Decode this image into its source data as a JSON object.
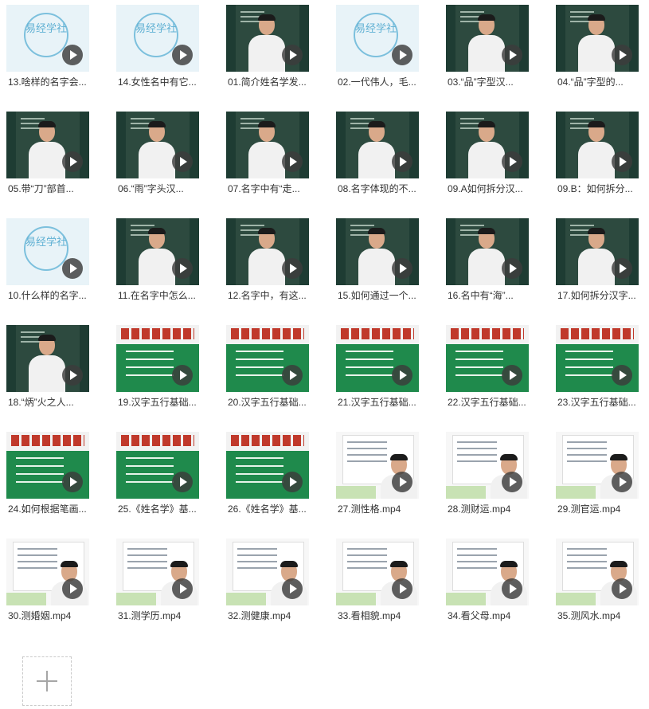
{
  "files": [
    {
      "label": "13.啥样的名字会...",
      "thumb": "logo"
    },
    {
      "label": "14.女性名中有它...",
      "thumb": "logo"
    },
    {
      "label": "01.简介姓名学发...",
      "thumb": "board"
    },
    {
      "label": "02.一代伟人，毛...",
      "thumb": "logo"
    },
    {
      "label": "03.“品”字型汉...",
      "thumb": "board"
    },
    {
      "label": "04.“品”字型的...",
      "thumb": "board"
    },
    {
      "label": "05.带“刀”部首...",
      "thumb": "board"
    },
    {
      "label": "06.“雨”字头汉...",
      "thumb": "board"
    },
    {
      "label": "07.名字中有“走...",
      "thumb": "board"
    },
    {
      "label": "08.名字体现的不...",
      "thumb": "board"
    },
    {
      "label": "09.A如何拆分汉...",
      "thumb": "board"
    },
    {
      "label": "09.B：如何拆分...",
      "thumb": "board"
    },
    {
      "label": "10.什么样的名字...",
      "thumb": "logo"
    },
    {
      "label": "11.在名字中怎么...",
      "thumb": "board"
    },
    {
      "label": "12.名字中，有这...",
      "thumb": "board"
    },
    {
      "label": "15.如何通过一个...",
      "thumb": "board"
    },
    {
      "label": "16.名中有“海”...",
      "thumb": "board"
    },
    {
      "label": "17.如何拆分汉字...",
      "thumb": "board"
    },
    {
      "label": "18.“炳”火之人...",
      "thumb": "board"
    },
    {
      "label": "19.汉字五行基础...",
      "thumb": "banner"
    },
    {
      "label": "20.汉字五行基础...",
      "thumb": "banner"
    },
    {
      "label": "21.汉字五行基础...",
      "thumb": "banner"
    },
    {
      "label": "22.汉字五行基础...",
      "thumb": "banner"
    },
    {
      "label": "23.汉字五行基础...",
      "thumb": "banner"
    },
    {
      "label": "24.如何根据笔画...",
      "thumb": "banner"
    },
    {
      "label": "25.《姓名学》基...",
      "thumb": "banner"
    },
    {
      "label": "26.《姓名学》基...",
      "thumb": "banner"
    },
    {
      "label": "27.测性格.mp4",
      "thumb": "slide"
    },
    {
      "label": "28.测财运.mp4",
      "thumb": "slide"
    },
    {
      "label": "29.测官运.mp4",
      "thumb": "slide"
    },
    {
      "label": "30.测婚姻.mp4",
      "thumb": "slide"
    },
    {
      "label": "31.测学历.mp4",
      "thumb": "slide"
    },
    {
      "label": "32.测健康.mp4",
      "thumb": "slide"
    },
    {
      "label": "33.看相貌.mp4",
      "thumb": "slide"
    },
    {
      "label": "34.看父母.mp4",
      "thumb": "slide"
    },
    {
      "label": "35.测风水.mp4",
      "thumb": "slide"
    }
  ],
  "logo_text": "易经学社",
  "icons": {
    "play": "play-icon",
    "add": "plus-icon"
  }
}
